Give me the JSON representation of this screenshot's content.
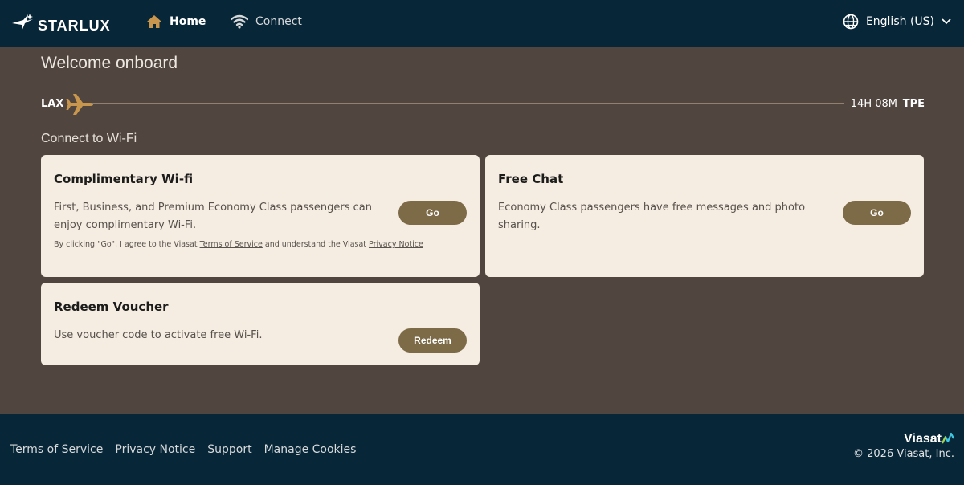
{
  "header": {
    "brand": "STARLUX",
    "nav": [
      {
        "label": "Home",
        "icon": "home-icon"
      },
      {
        "label": "Connect",
        "icon": "wifi-icon"
      }
    ],
    "language": "English (US)"
  },
  "welcome": "Welcome onboard",
  "flight": {
    "origin": "LAX",
    "destination": "TPE",
    "remaining": "14H 08M"
  },
  "section_title": "Connect to Wi-Fi",
  "cards": {
    "wifi": {
      "title": "Complimentary Wi-fi",
      "description": "First, Business, and Premium Economy Class passengers can enjoy complimentary Wi-Fi.",
      "button": "Go",
      "terms_prefix": "By clicking \"Go\", I agree to the Viasat ",
      "terms_link": "Terms of Service",
      "terms_middle": " and understand the Viasat ",
      "privacy_link": "Privacy Notice"
    },
    "chat": {
      "title": "Free Chat",
      "description": "Economy Class passengers have free messages and photo sharing.",
      "button": "Go"
    },
    "voucher": {
      "title": "Redeem Voucher",
      "description": "Use voucher code to activate free Wi-Fi.",
      "button": "Redeem"
    }
  },
  "footer": {
    "links": [
      "Terms of Service",
      "Privacy Notice",
      "Support",
      "Manage Cookies"
    ],
    "partner": "Viasat",
    "copyright": "© 2026 Viasat, Inc."
  },
  "colors": {
    "header_bg": "#072638",
    "page_bg": "#51463f",
    "card_bg": "#f5ece2",
    "button_bg": "#7d6b48",
    "accent_gold": "#c9964e"
  }
}
